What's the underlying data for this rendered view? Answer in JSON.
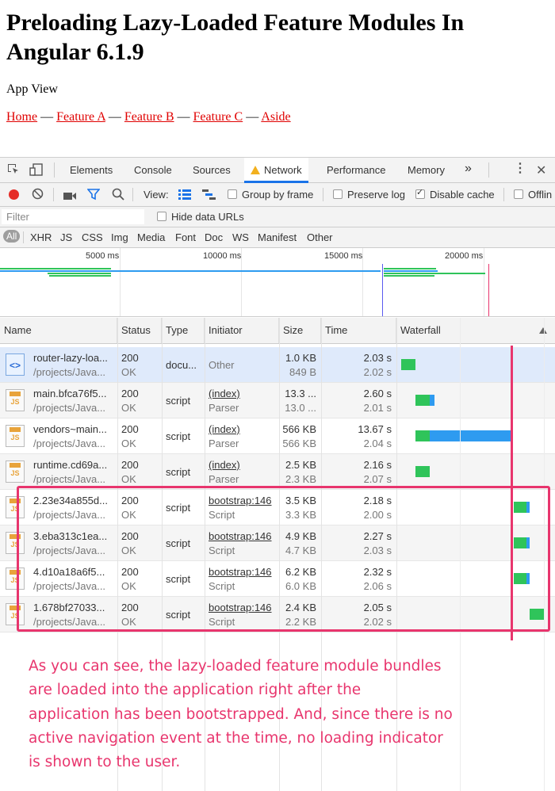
{
  "app": {
    "title": "Preloading Lazy-Loaded Feature Modules In Angular 6.1.9",
    "view_label": "App View",
    "nav": [
      "Home",
      "Feature A",
      "Feature B",
      "Feature C",
      "Aside"
    ],
    "separator": "—",
    "link_color": "#e00000"
  },
  "devtools": {
    "tabs": [
      "Elements",
      "Console",
      "Sources",
      "Network",
      "Performance",
      "Memory"
    ],
    "active_tab": "Network",
    "more": "»",
    "menu_icon": "kebab-icon",
    "close_icon": "close-icon",
    "toolbar": {
      "view_label": "View:",
      "group_by_frame": "Group by frame",
      "preserve_log": "Preserve log",
      "disable_cache": "Disable cache",
      "offline": "Offlin",
      "disable_cache_checked": true,
      "record_color": "#e52d27"
    },
    "filter": {
      "placeholder": "Filter",
      "hide_data_urls": "Hide data URLs"
    },
    "types": [
      "All",
      "XHR",
      "JS",
      "CSS",
      "Img",
      "Media",
      "Font",
      "Doc",
      "WS",
      "Manifest",
      "Other"
    ],
    "overview_ticks": [
      "5000 ms",
      "10000 ms",
      "15000 ms",
      "20000 ms"
    ],
    "columns": [
      "Name",
      "Status",
      "Type",
      "Initiator",
      "Size",
      "Time",
      "Waterfall"
    ],
    "rows": [
      {
        "name": "router-lazy-loa...",
        "path": "/projects/Java...",
        "status": "200",
        "status_text": "OK",
        "type": "docu...",
        "initiator": "Other",
        "initiator_sub": "",
        "size": "1.0 KB",
        "size_sub": "849 B",
        "time": "2.03 s",
        "time_sub": "2.02 s",
        "icon": "html",
        "selected": true
      },
      {
        "name": "main.bfca76f5...",
        "path": "/projects/Java...",
        "status": "200",
        "status_text": "OK",
        "type": "script",
        "initiator": "(index)",
        "initiator_sub": "Parser",
        "size": "13.3 ...",
        "size_sub": "13.0 ...",
        "time": "2.60 s",
        "time_sub": "2.01 s",
        "icon": "js"
      },
      {
        "name": "vendors~main...",
        "path": "/projects/Java...",
        "status": "200",
        "status_text": "OK",
        "type": "script",
        "initiator": "(index)",
        "initiator_sub": "Parser",
        "size": "566 KB",
        "size_sub": "566 KB",
        "time": "13.67 s",
        "time_sub": "2.04 s",
        "icon": "js"
      },
      {
        "name": "runtime.cd69a...",
        "path": "/projects/Java...",
        "status": "200",
        "status_text": "OK",
        "type": "script",
        "initiator": "(index)",
        "initiator_sub": "Parser",
        "size": "2.5 KB",
        "size_sub": "2.3 KB",
        "time": "2.16 s",
        "time_sub": "2.07 s",
        "icon": "js"
      },
      {
        "name": "2.23e34a855d...",
        "path": "/projects/Java...",
        "status": "200",
        "status_text": "OK",
        "type": "script",
        "initiator": "bootstrap:146",
        "initiator_sub": "Script",
        "size": "3.5 KB",
        "size_sub": "3.3 KB",
        "time": "2.18 s",
        "time_sub": "2.00 s",
        "icon": "js"
      },
      {
        "name": "3.eba313c1ea...",
        "path": "/projects/Java...",
        "status": "200",
        "status_text": "OK",
        "type": "script",
        "initiator": "bootstrap:146",
        "initiator_sub": "Script",
        "size": "4.9 KB",
        "size_sub": "4.7 KB",
        "time": "2.27 s",
        "time_sub": "2.03 s",
        "icon": "js"
      },
      {
        "name": "4.d10a18a6f5...",
        "path": "/projects/Java...",
        "status": "200",
        "status_text": "OK",
        "type": "script",
        "initiator": "bootstrap:146",
        "initiator_sub": "Script",
        "size": "6.2 KB",
        "size_sub": "6.0 KB",
        "time": "2.32 s",
        "time_sub": "2.06 s",
        "icon": "js"
      },
      {
        "name": "1.678bf27033...",
        "path": "/projects/Java...",
        "status": "200",
        "status_text": "OK",
        "type": "script",
        "initiator": "bootstrap:146",
        "initiator_sub": "Script",
        "size": "2.4 KB",
        "size_sub": "2.2 KB",
        "time": "2.05 s",
        "time_sub": "2.02 s",
        "icon": "js"
      }
    ],
    "colors": {
      "waiting": "#2fc45a",
      "download": "#2e9bf0",
      "accent": "#1a73e8",
      "highlight": "#e8356d"
    }
  },
  "annotation": "As you can see, the lazy-loaded feature module bundles\nare loaded into the application right after the\napplication has been bootstrapped. And, since there is no\nactive navigation event at the time, no loading indicator\nis shown to the user."
}
